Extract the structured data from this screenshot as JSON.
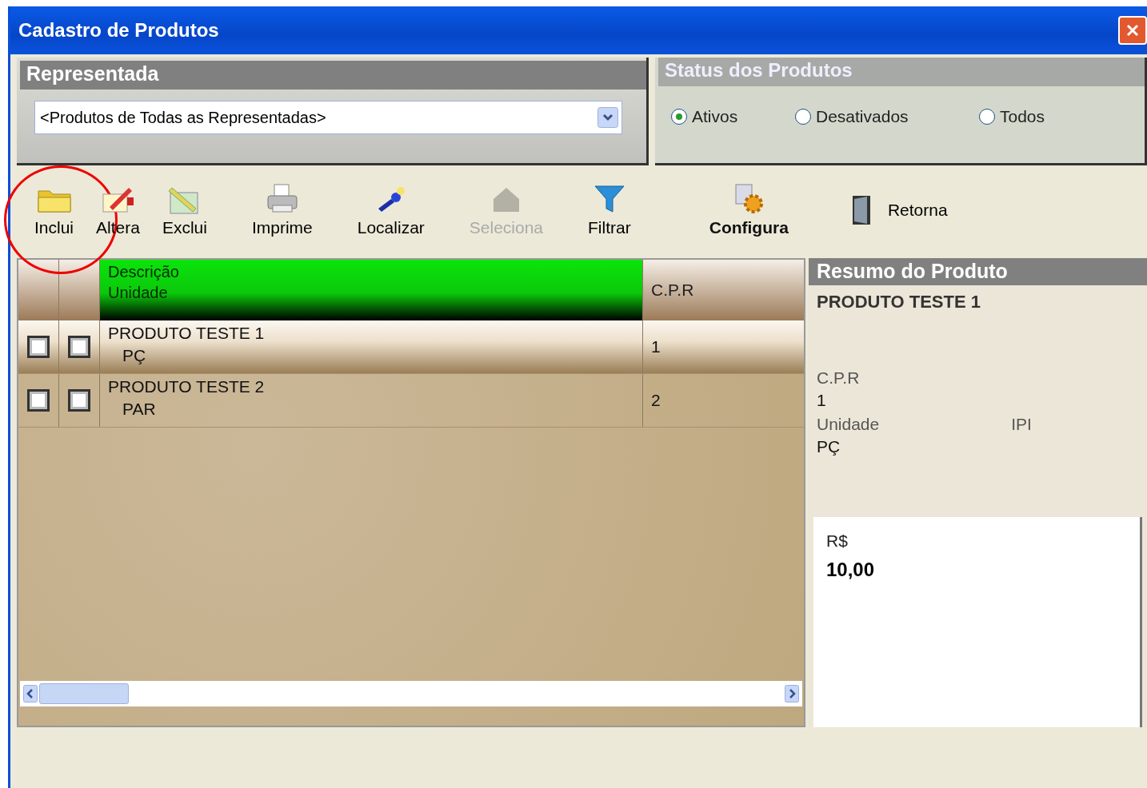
{
  "window": {
    "title": "Cadastro de Produtos"
  },
  "representada": {
    "title": "Representada",
    "value": "<Produtos de Todas as Representadas>"
  },
  "status": {
    "title": "Status dos Produtos",
    "options": [
      {
        "label": "Ativos",
        "selected": true
      },
      {
        "label": "Desativados",
        "selected": false
      },
      {
        "label": "Todos",
        "selected": false
      }
    ]
  },
  "toolbar": [
    {
      "kind": "folder",
      "label": "Inclui",
      "disabled": false,
      "circled": true
    },
    {
      "kind": "edit",
      "label": "Altera",
      "disabled": false,
      "circled": false
    },
    {
      "kind": "delete",
      "label": "Exclui",
      "disabled": false,
      "circled": false
    },
    {
      "kind": "print",
      "label": "Imprime",
      "disabled": false,
      "circled": false
    },
    {
      "kind": "find",
      "label": "Localizar",
      "disabled": false,
      "circled": false
    },
    {
      "kind": "select",
      "label": "Seleciona",
      "disabled": true,
      "circled": false
    },
    {
      "kind": "filter",
      "label": "Filtrar",
      "disabled": false,
      "circled": false
    },
    {
      "kind": "config",
      "label": "Configura",
      "disabled": false,
      "circled": false
    },
    {
      "kind": "exit",
      "label": "Retorna",
      "disabled": false,
      "circled": false
    }
  ],
  "table": {
    "columns": [
      "Descrição",
      "Unidade",
      "C.P.R"
    ],
    "rows": [
      {
        "name": "PRODUTO TESTE 1",
        "unit": "PÇ",
        "cpr": "1",
        "selected": true,
        "check_1": false,
        "check_2": false
      },
      {
        "name": "PRODUTO TESTE 2",
        "unit": "PAR",
        "cpr": "2",
        "selected": false,
        "check_1": false,
        "check_2": false
      }
    ]
  },
  "summary": {
    "title": "Resumo do Produto",
    "product": "PRODUTO TESTE 1",
    "cpr_label": "C.P.R",
    "cpr": "1",
    "unit_label": "Unidade",
    "ipi_label": "IPI",
    "unit": "PÇ",
    "currency": "R$",
    "price": "10,00"
  }
}
